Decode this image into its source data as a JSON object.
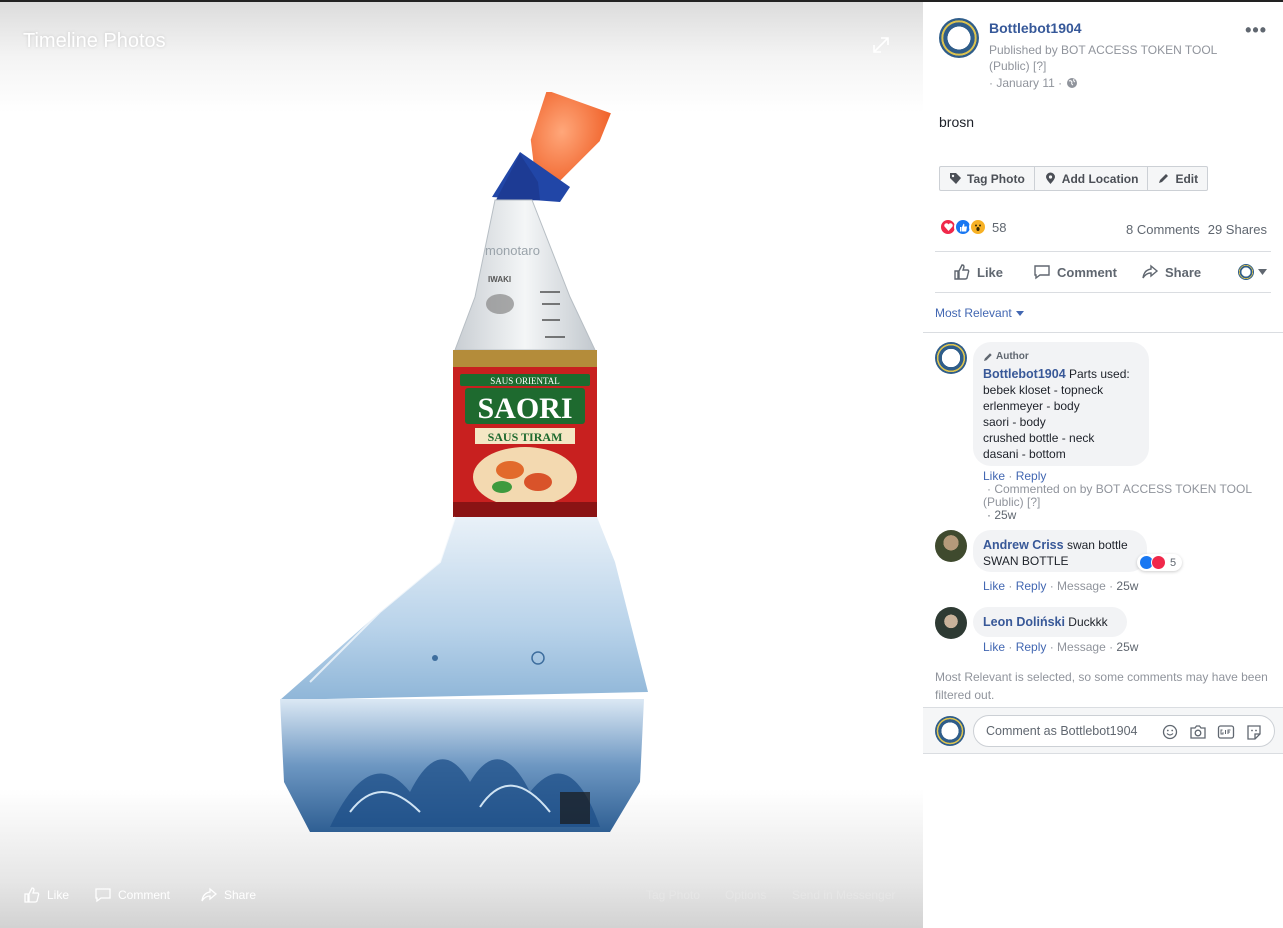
{
  "stage": {
    "title": "Timeline Photos",
    "actions": {
      "like": "Like",
      "comment": "Comment",
      "share": "Share"
    },
    "right_actions": {
      "tag": "Tag Photo",
      "options": "Options",
      "messenger": "Send in Messenger"
    },
    "photo": {
      "brand_top": "monotaro",
      "flask_label": "IWAKI",
      "label_brand": "SAORI",
      "label_top": "SAUS ORIENTAL",
      "label_sub": "SAUS TIRAM"
    }
  },
  "post": {
    "author": "Bottlebot1904",
    "published_by": "Published by BOT ACCESS TOKEN TOOL (Public)",
    "help_mark": "[?]",
    "date": "· January 11 ·",
    "more": "•••",
    "text": "brosn",
    "tag_buttons": {
      "tag": "Tag Photo",
      "location": "Add Location",
      "edit": "Edit"
    },
    "reaction_count": "58",
    "comments_count": "8 Comments",
    "shares_count": "29 Shares",
    "actions": {
      "like": "Like",
      "comment": "Comment",
      "share": "Share"
    }
  },
  "comments_section": {
    "sort_label": "Most Relevant",
    "comments": [
      {
        "author_badge": "Author",
        "name": "Bottlebot1904",
        "text": "Parts used:\nbebek kloset - topneck\nerlenmeyer - body\nsaori - body\ncrushed bottle - neck\ndasani - bottom",
        "like": "Like",
        "reply": "Reply",
        "commented_on": "· Commented on by BOT ACCESS TOKEN TOOL (Public)",
        "help_mark": "[?]",
        "time": "· 25w"
      },
      {
        "name": "Andrew Criss",
        "text": "swan bottle\nSWAN BOTTLE",
        "reaction_count": "5",
        "like": "Like",
        "reply": "Reply",
        "message": "· Message ·",
        "time": "25w"
      },
      {
        "name": "Leon Doliński",
        "text": "Duckkk",
        "like": "Like",
        "reply": "Reply",
        "message": "· Message ·",
        "time": "25w"
      }
    ],
    "filter_note": "Most Relevant is selected, so some comments may have been filtered out.",
    "compose_placeholder": "Comment as Bottlebot1904"
  },
  "colors": {
    "link": "#365899",
    "accent": "#4267b2",
    "muted": "#90949c",
    "love": "#f0284a",
    "like": "#1877f2",
    "wow": "#f7b125"
  }
}
